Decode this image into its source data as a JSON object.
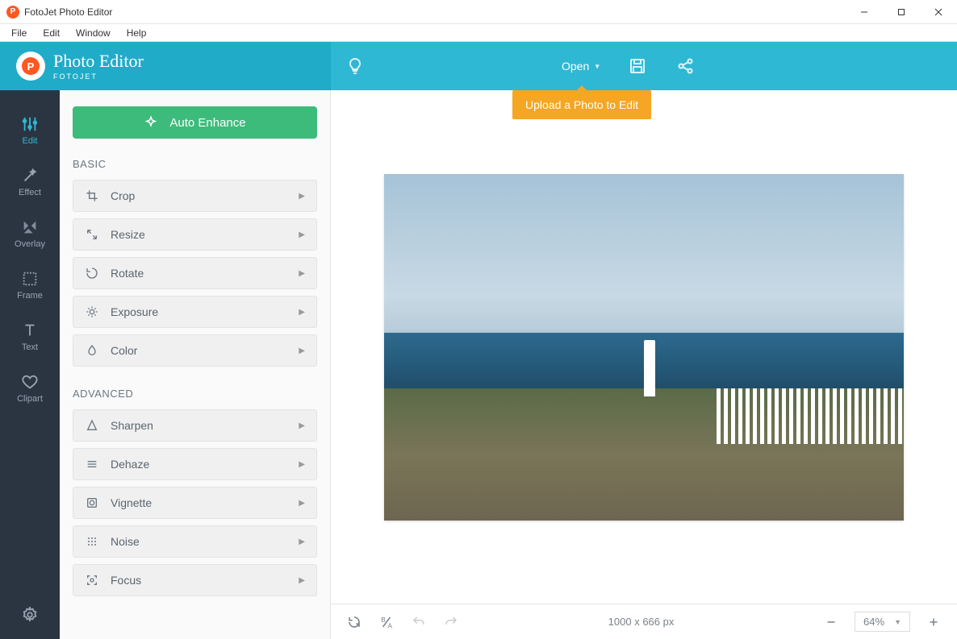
{
  "window": {
    "title": "FotoJet Photo Editor"
  },
  "menus": {
    "file": "File",
    "edit": "Edit",
    "window": "Window",
    "help": "Help"
  },
  "brand": {
    "name": "Photo Editor",
    "sub": "FOTOJET"
  },
  "ribbon": {
    "open": "Open",
    "upload_tip": "Upload a Photo to Edit"
  },
  "nav": {
    "edit": "Edit",
    "effect": "Effect",
    "overlay": "Overlay",
    "frame": "Frame",
    "text": "Text",
    "clipart": "Clipart"
  },
  "panel": {
    "auto_enhance": "Auto Enhance",
    "basic_label": "BASIC",
    "basic": {
      "crop": "Crop",
      "resize": "Resize",
      "rotate": "Rotate",
      "exposure": "Exposure",
      "color": "Color"
    },
    "advanced_label": "ADVANCED",
    "advanced": {
      "sharpen": "Sharpen",
      "dehaze": "Dehaze",
      "vignette": "Vignette",
      "noise": "Noise",
      "focus": "Focus"
    }
  },
  "status": {
    "dimensions": "1000 x 666 px",
    "zoom": "64%"
  }
}
